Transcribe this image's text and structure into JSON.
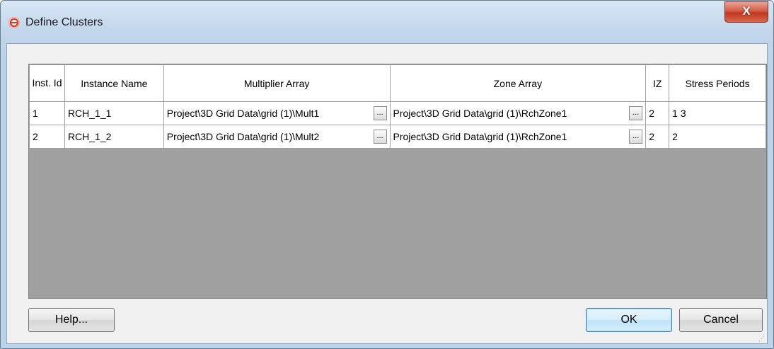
{
  "window": {
    "title": "Define Clusters",
    "close_label": "X"
  },
  "table": {
    "columns": [
      "Inst. Id",
      "Instance Name",
      "Multiplier Array",
      "Zone Array",
      "IZ",
      "Stress Periods"
    ],
    "rows": [
      {
        "id": "1",
        "name": "RCH_1_1",
        "multiplier": "Project\\3D Grid Data\\grid (1)\\Mult1",
        "zone": "Project\\3D Grid Data\\grid (1)\\RchZone1",
        "iz": "2",
        "stress": "1 3"
      },
      {
        "id": "2",
        "name": "RCH_1_2",
        "multiplier": "Project\\3D Grid Data\\grid (1)\\Mult2",
        "zone": "Project\\3D Grid Data\\grid (1)\\RchZone1",
        "iz": "2",
        "stress": "2"
      }
    ],
    "ellipsis_label": "..."
  },
  "buttons": {
    "help": "Help...",
    "ok": "OK",
    "cancel": "Cancel"
  },
  "colors": {
    "empty_grid_area": "#a0a0a0",
    "close_button": "#c94a31",
    "default_button_border": "#3c7fb1"
  }
}
